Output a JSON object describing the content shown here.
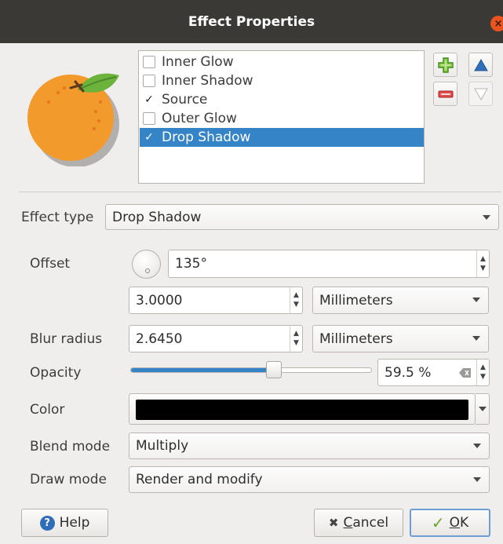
{
  "window": {
    "title": "Effect Properties",
    "close_glyph": "×"
  },
  "effects": [
    {
      "label": "Inner Glow",
      "checked": false,
      "mark": ""
    },
    {
      "label": "Inner Shadow",
      "checked": false,
      "mark": ""
    },
    {
      "label": "Source",
      "checked": true,
      "mark": "✓"
    },
    {
      "label": "Outer Glow",
      "checked": false,
      "mark": ""
    },
    {
      "label": "Drop Shadow",
      "checked": true,
      "mark": "✓",
      "selected": true
    }
  ],
  "list_buttons": {
    "add_icon": "add-effect-icon",
    "remove_icon": "remove-effect-icon",
    "up_icon": "move-up-icon",
    "down_icon": "move-down-icon"
  },
  "effect_type": {
    "label": "Effect type",
    "value": "Drop Shadow"
  },
  "offset": {
    "label": "Offset",
    "angle": "135°",
    "distance": "3.0000",
    "unit": "Millimeters"
  },
  "blur": {
    "label": "Blur radius",
    "value": "2.6450",
    "unit": "Millimeters"
  },
  "opacity": {
    "label": "Opacity",
    "value": "59.5 %",
    "fraction": 0.595
  },
  "color": {
    "label": "Color",
    "value": "#000000"
  },
  "blend_mode": {
    "label": "Blend mode",
    "value": "Multiply"
  },
  "draw_mode": {
    "label": "Draw mode",
    "value": "Render and modify"
  },
  "buttons": {
    "help": "Help",
    "cancel": "Cancel",
    "ok": "OK"
  },
  "colors": {
    "accent": "#3584c8",
    "titlebar": "#3a3936",
    "close": "#e9541e"
  }
}
